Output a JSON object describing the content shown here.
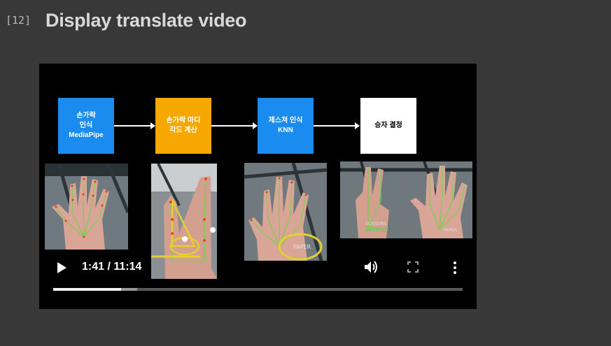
{
  "cell": {
    "prompt": "[12]",
    "title": "Display translate video"
  },
  "video": {
    "flow": [
      {
        "lines": [
          "손가락",
          "인식",
          "MediaPipe"
        ]
      },
      {
        "lines": [
          "손가락 마디",
          "각도 계산"
        ]
      },
      {
        "lines": [
          "제스쳐 인식",
          "KNN"
        ]
      },
      {
        "lines": [
          "승자 결정"
        ]
      }
    ],
    "photo_labels": {
      "paper1": "PAPER",
      "scissors": "SCISSORS",
      "winner": "Winner",
      "paper2": "PAPER"
    },
    "player": {
      "time": "1:41 / 11:14",
      "progress": 0.165,
      "buffered": 0.205,
      "icons": {
        "play": "play-icon",
        "volume": "volume-icon",
        "fullscreen": "fullscreen-icon",
        "more": "more-vert-icon"
      }
    }
  }
}
